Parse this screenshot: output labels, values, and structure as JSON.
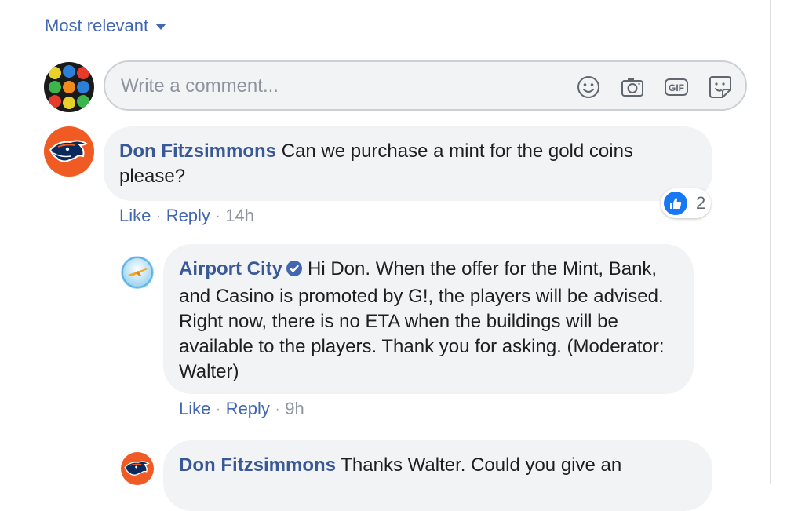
{
  "sort": {
    "label": "Most relevant"
  },
  "composer": {
    "placeholder": "Write a comment...",
    "icons": [
      "emoji-icon",
      "camera-icon",
      "gif-icon",
      "sticker-icon"
    ]
  },
  "comments": [
    {
      "author": "Don Fitzsimmons",
      "text": "Can we purchase a mint for the gold coins please?",
      "like_label": "Like",
      "reply_label": "Reply",
      "time": "14h",
      "reaction_count": "2"
    }
  ],
  "replies": [
    {
      "author": "Airport City",
      "verified": true,
      "text": "Hi Don. When the offer for the Mint, Bank, and Casino is promoted by G!, the players will be advised. Right now, there is no ETA when the buildings will be available to the players. Thank you for asking. (Moderator: Walter)",
      "like_label": "Like",
      "reply_label": "Reply",
      "time": "9h"
    },
    {
      "author": "Don Fitzsimmons",
      "text": "Thanks Walter. Could you give an"
    }
  ],
  "colors": {
    "link": "#4267b2",
    "author": "#385898",
    "bubble": "#f2f3f5",
    "like_blue": "#1877f2",
    "team_orange": "#f05a23"
  }
}
